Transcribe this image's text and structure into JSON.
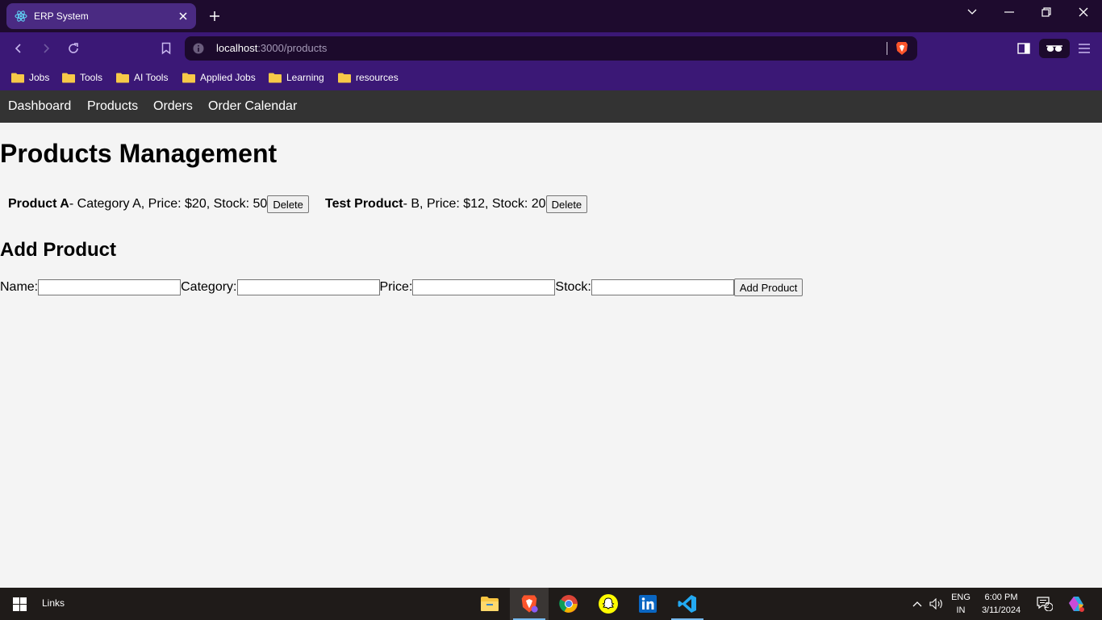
{
  "browser": {
    "tab_title": "ERP System",
    "url_host": "localhost",
    "url_path": ":3000/products",
    "bookmarks": [
      {
        "label": "Jobs"
      },
      {
        "label": "Tools"
      },
      {
        "label": "AI Tools"
      },
      {
        "label": "Applied Jobs"
      },
      {
        "label": "Learning"
      },
      {
        "label": "resources"
      }
    ]
  },
  "app_nav": {
    "links": [
      "Dashboard",
      "Products",
      "Orders",
      "Order Calendar"
    ]
  },
  "page": {
    "title": "Products Management",
    "products": [
      {
        "name": "Product A",
        "details": " - Category A, Price: $20, Stock: 50",
        "delete_label": "Delete"
      },
      {
        "name": "Test Product",
        "details": " - B, Price: $12, Stock: 20",
        "delete_label": "Delete"
      }
    ],
    "add_section_title": "Add Product",
    "form": {
      "name_label": "Name:",
      "category_label": "Category:",
      "price_label": "Price:",
      "stock_label": "Stock:",
      "name_value": "",
      "category_value": "",
      "price_value": "",
      "stock_value": "",
      "submit_label": "Add Product"
    }
  },
  "taskbar": {
    "links_label": "Links",
    "apps": [
      "file-explorer-icon",
      "brave-browser-icon",
      "chrome-icon",
      "snapchat-icon",
      "linkedin-icon",
      "vscode-icon"
    ],
    "lang_line1": "ENG",
    "lang_line2": "IN",
    "time": "6:00 PM",
    "date": "3/11/2024",
    "notification_count": "2"
  },
  "colors": {
    "tab_strip": "#1e0b2e",
    "toolbar_purple": "#3b1876",
    "active_tab": "#4a2a82",
    "app_navbar": "#333333",
    "page_bg": "#f4f4f4",
    "taskbar": "#1f1b19"
  }
}
